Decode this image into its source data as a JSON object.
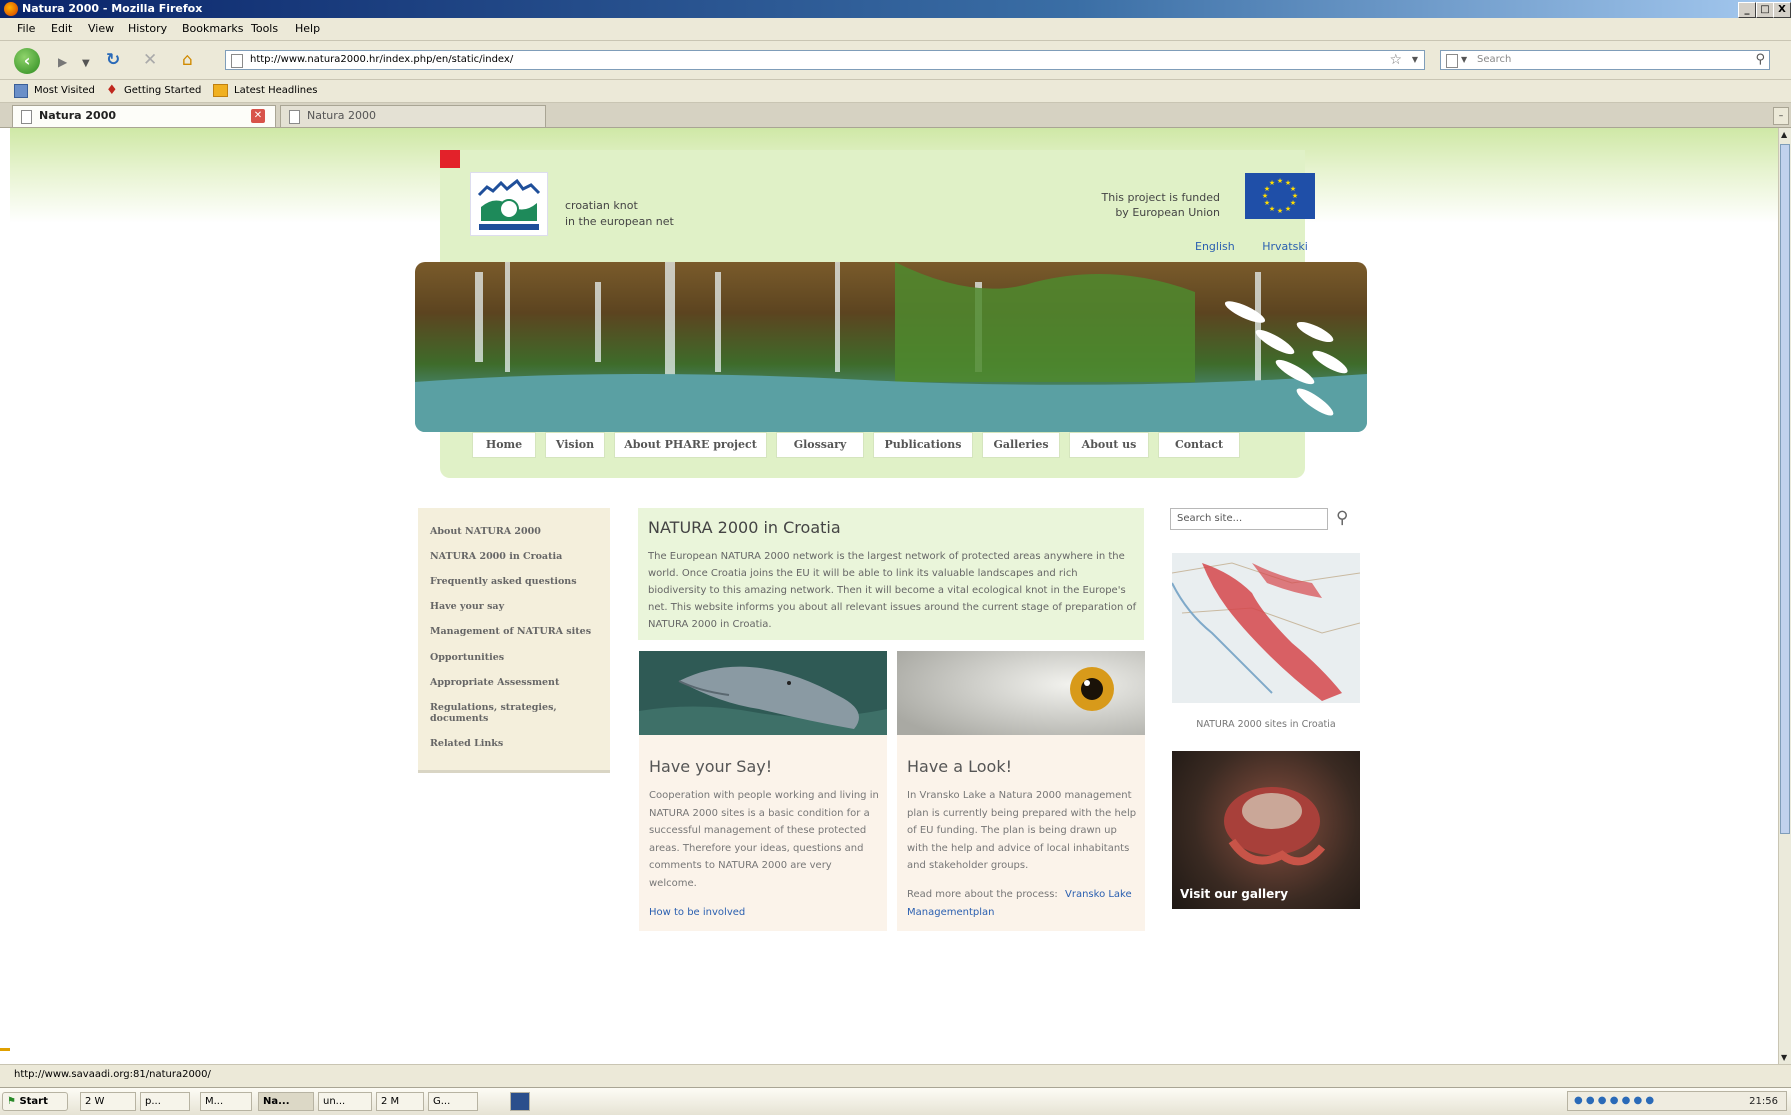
{
  "window": {
    "title": "Natura 2000 - Mozilla Firefox",
    "controls": [
      "_",
      "□",
      "X"
    ]
  },
  "menu": [
    "File",
    "Edit",
    "View",
    "History",
    "Bookmarks",
    "Tools",
    "Help"
  ],
  "toolbar": {
    "url": "http://www.natura2000.hr/index.php/en/static/index/",
    "search_placeholder": "Search"
  },
  "bookmarks": [
    "Most Visited",
    "Getting Started",
    "Latest Headlines"
  ],
  "tabs": [
    {
      "label": "Natura 2000",
      "active": true
    },
    {
      "label": "Natura 2000",
      "active": false
    }
  ],
  "page": {
    "tagline1": "croatian knot",
    "tagline2": "in the european net",
    "funded1": "This project is funded",
    "funded2": "by European Union",
    "lang_en": "English",
    "lang_hr": "Hrvatski",
    "nav": [
      "Home",
      "Vision",
      "About PHARE project",
      "Glossary",
      "Publications",
      "Galleries",
      "About us",
      "Contact"
    ],
    "left_menu": [
      "About NATURA 2000",
      "NATURA 2000 in Croatia",
      "Frequently asked questions",
      "Have your say",
      "Management of NATURA sites",
      "Opportunities",
      "Appropriate Assessment",
      "Regulations, strategies,",
      "documents",
      "Related Links"
    ],
    "intro": {
      "title": "NATURA 2000 in Croatia",
      "text": "The European NATURA 2000 network is the largest network of protected areas anywhere in the world. Once Croatia joins the EU it will be able to link its valuable landscapes and rich biodiversity to this amazing network. Then it will become a vital ecological knot in the Europe's net. This website informs you about all relevant issues around the current stage of preparation of NATURA 2000 in Croatia."
    },
    "card_say": {
      "title": "Have your Say!",
      "text": "Cooperation with people working and living in NATURA 2000 sites is a basic condition for a successful management of these protected areas. Therefore your ideas, questions and comments to NATURA 2000 are very welcome.",
      "link": "How to be involved"
    },
    "card_look": {
      "title": "Have a Look!",
      "text": "In Vransko Lake a Natura 2000 management plan is currently being prepared with the help of EU funding. The plan is being drawn up with the help and advice of local inhabitants and stakeholder groups.",
      "link_prefix": "Read more about the process:",
      "link1": "Vransko Lake",
      "link2": "Managementplan"
    },
    "site_search_placeholder": "Search site...",
    "map_caption": "NATURA 2000 sites in Croatia",
    "gallery_caption": "Visit our gallery"
  },
  "status_text": "http://www.savaadi.org:81/natura2000/",
  "taskbar": {
    "start": "Start",
    "items": [
      "2 W",
      "p...",
      "M...",
      "Na...",
      "un...",
      "2 M",
      "G..."
    ],
    "clock": "21:56"
  },
  "colors": {
    "accent_green": "#e0f1c7",
    "link_blue": "#2a5fb0",
    "eu_blue": "#1f4fa8",
    "red_square": "#e3222a"
  }
}
